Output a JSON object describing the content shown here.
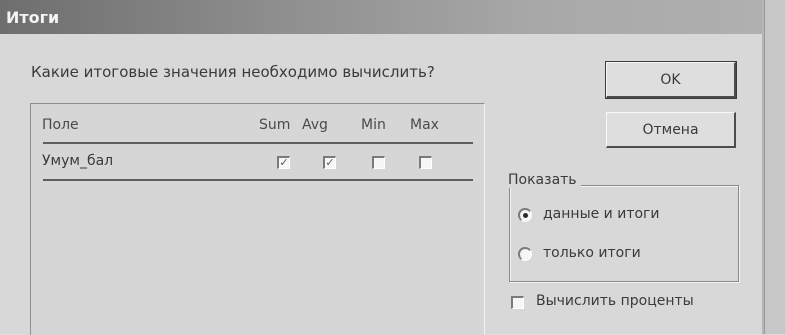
{
  "window": {
    "title": "Итоги"
  },
  "prompt": "Какие итоговые значения необходимо вычислить?",
  "table": {
    "columns": {
      "field": "Поле",
      "sum": "Sum",
      "avg": "Avg",
      "min": "Min",
      "max": "Max"
    },
    "rows": [
      {
        "name": "Умум_бал",
        "sum": true,
        "avg": true,
        "min": false,
        "max": false
      }
    ]
  },
  "buttons": {
    "ok": "OK",
    "cancel": "Отмена"
  },
  "show_group": {
    "legend": "Показать",
    "options": [
      {
        "label": "данные и итоги",
        "selected": true
      },
      {
        "label": "только итоги",
        "selected": false
      }
    ]
  },
  "percent_checkbox": {
    "label": "Вычислить проценты",
    "checked": false
  },
  "icons": {
    "check": "checkmark-icon"
  }
}
